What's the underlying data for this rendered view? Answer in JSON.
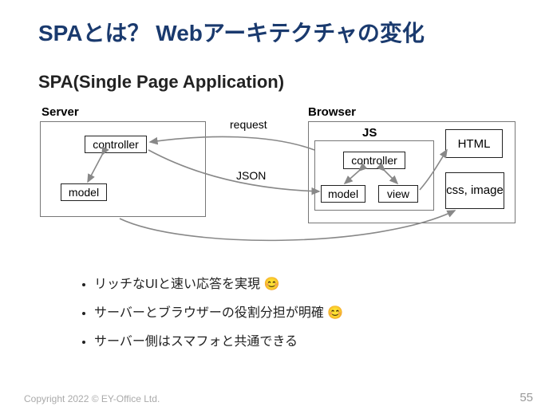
{
  "title": "SPAとは？ Webアーキテクチャの変化",
  "subtitle": "SPA(Single Page Application)",
  "diagram": {
    "server_label": "Server",
    "browser_label": "Browser",
    "server": {
      "controller": "controller",
      "model": "model"
    },
    "browser": {
      "js": "JS",
      "controller": "controller",
      "model": "model",
      "view": "view",
      "html": "HTML",
      "css_image": "css, image"
    },
    "request": "request",
    "json": "JSON"
  },
  "bullets": [
    {
      "text": "リッチなUIと速い応答を実現",
      "emoji": "😊"
    },
    {
      "text": "サーバーとブラウザーの役割分担が明確",
      "emoji": "😊"
    },
    {
      "text": "サーバー側はスマフォと共通できる",
      "emoji": ""
    }
  ],
  "footer": "Copyright 2022 © EY-Office Ltd.",
  "page": "55"
}
